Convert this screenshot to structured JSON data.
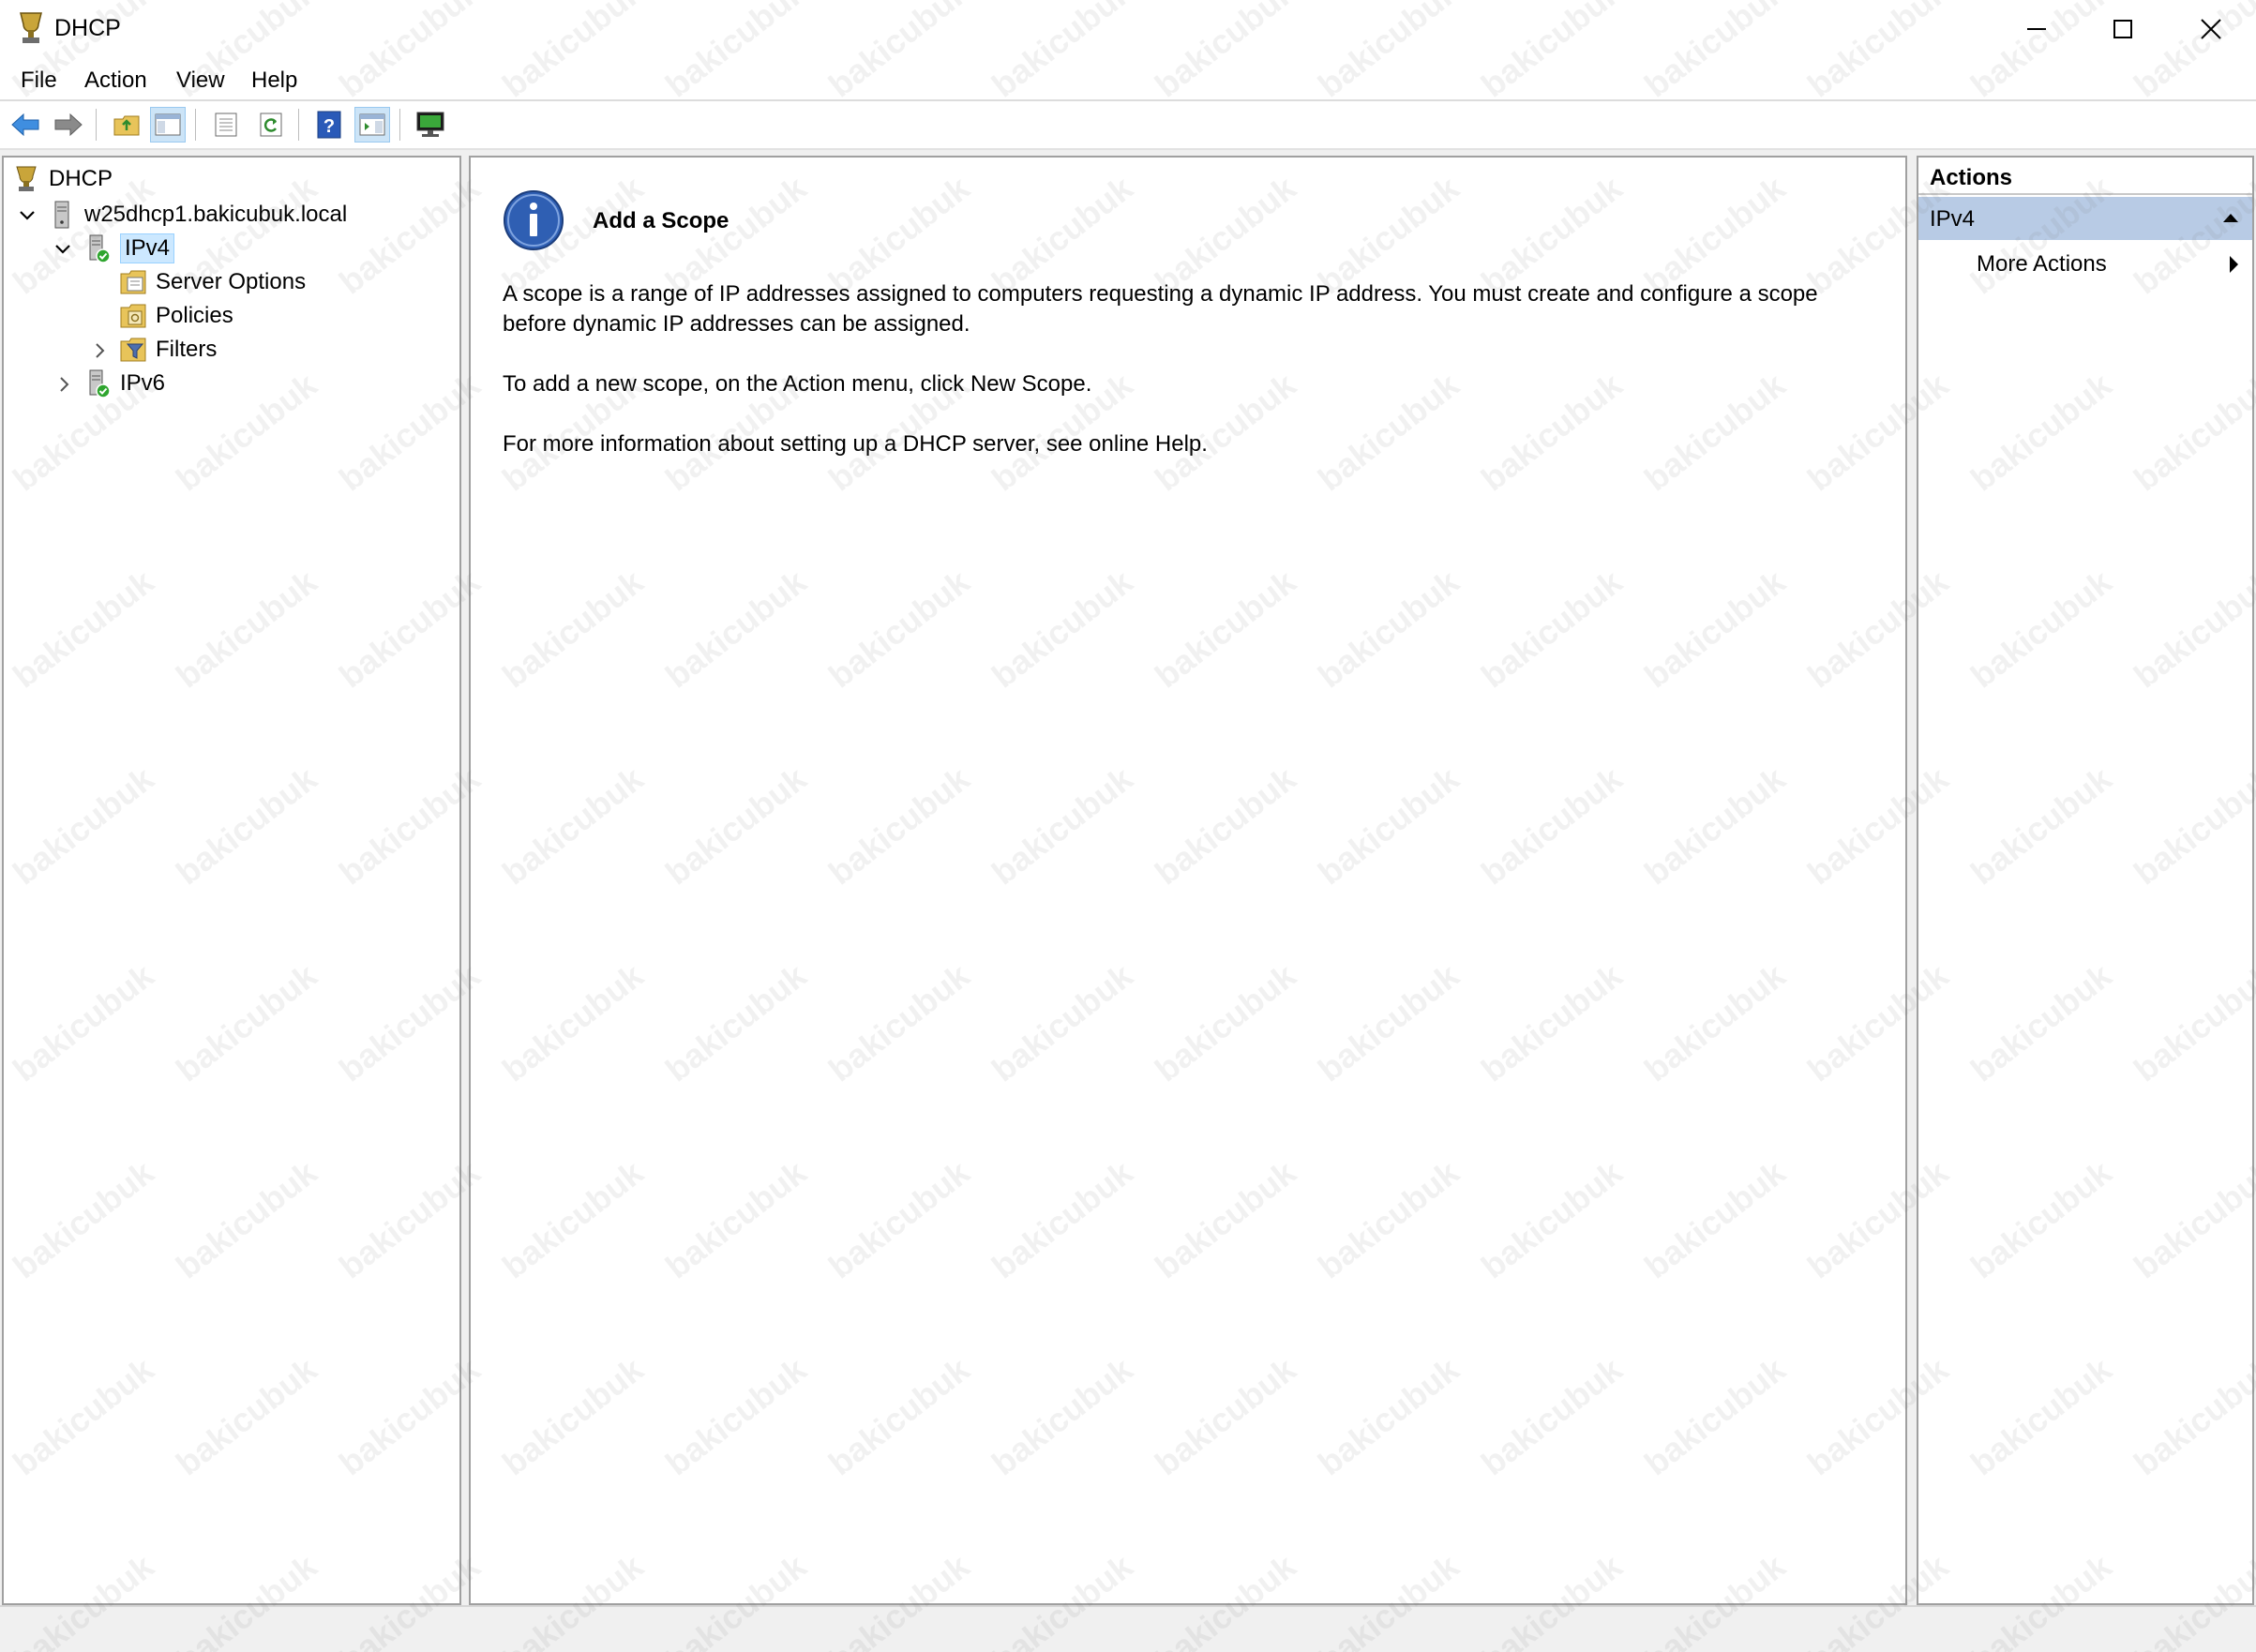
{
  "window": {
    "title": "DHCP",
    "controls": {
      "minimize": "minimize-icon",
      "maximize": "maximize-icon",
      "close": "close-icon"
    }
  },
  "menu": [
    "File",
    "Action",
    "View",
    "Help"
  ],
  "toolbar": {
    "icons": [
      "back-arrow-icon",
      "forward-arrow-icon",
      "up-folder-icon",
      "show-hide-console-tree-icon",
      "export-list-icon",
      "refresh-icon",
      "help-icon",
      "show-hide-action-pane-icon",
      "dhcp-server-monitor-icon"
    ]
  },
  "tree": {
    "root": "DHCP",
    "server": "w25dhcp1.bakicubuk.local",
    "ipv4": "IPv4",
    "server_options": "Server Options",
    "policies": "Policies",
    "filters": "Filters",
    "ipv6": "IPv6"
  },
  "result": {
    "title": "Add a Scope",
    "paragraph1": "A scope is a range of IP addresses assigned to computers requesting a dynamic IP address. You must create and configure a scope before dynamic IP addresses can be assigned.",
    "paragraph2": "To add a new scope, on the Action menu, click New Scope.",
    "paragraph3": "For more information about setting up a DHCP server, see online Help."
  },
  "actions": {
    "header": "Actions",
    "group": "IPv4",
    "more": "More Actions"
  },
  "watermark": "bakicubuk",
  "colors": {
    "selection": "#cce8ff",
    "action_group": "#b8cbe5",
    "pane_border": "#a0a0a0"
  }
}
